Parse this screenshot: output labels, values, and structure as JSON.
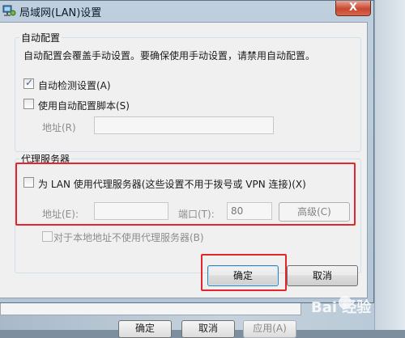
{
  "window": {
    "title": "局域网(LAN)设置",
    "close_glyph": "X"
  },
  "auto_config": {
    "group_label": "自动配置",
    "description": "自动配置会覆盖手动设置。要确保使用手动设置，请禁用自动配置。",
    "auto_detect_label": "自动检测设置(A)",
    "auto_detect_checked": true,
    "script_label": "使用自动配置脚本(S)",
    "script_checked": false,
    "address_label": "地址(R)",
    "address_value": ""
  },
  "proxy": {
    "group_label": "代理服务器",
    "use_proxy_label": "为 LAN 使用代理服务器(这些设置不用于拨号或 VPN 连接)(X)",
    "use_proxy_checked": false,
    "address_label": "地址(E):",
    "address_value": "",
    "port_label": "端口(T):",
    "port_value": "80",
    "advanced_label": "高级(C)",
    "bypass_local_label": "对于本地地址不使用代理服务器(B)",
    "bypass_local_checked": false
  },
  "buttons": {
    "ok": "确定",
    "cancel": "取消"
  },
  "background_dialog": {
    "ok": "确定",
    "cancel": "取消",
    "apply": "应用(A)"
  },
  "watermark": "Bai 经验",
  "colors": {
    "highlight": "#e4262c",
    "titlebar": "#b9cad9",
    "close": "#c8472f"
  }
}
